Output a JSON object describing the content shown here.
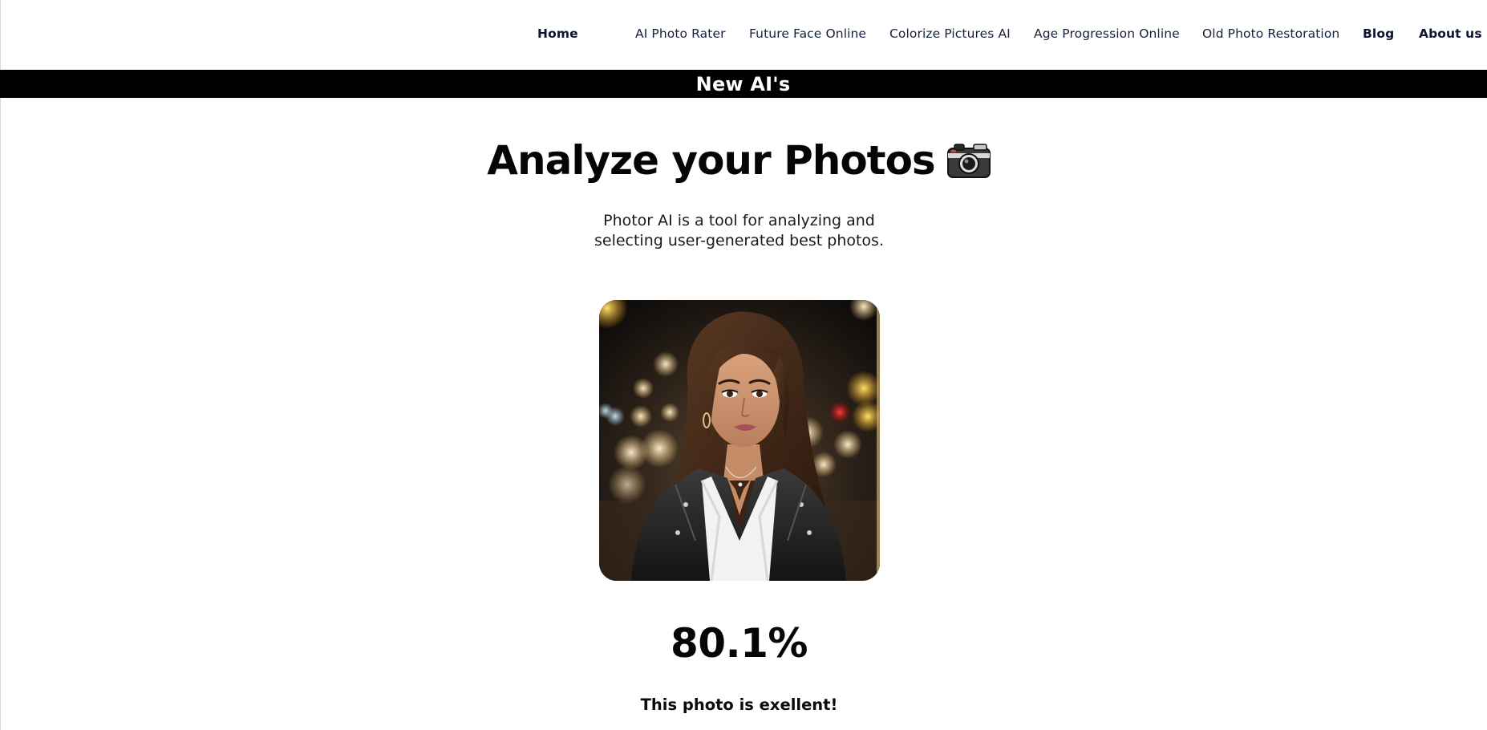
{
  "nav": {
    "items": [
      {
        "label": "Home",
        "bold": true
      },
      {
        "label": "AI Photo Rater",
        "bold": false
      },
      {
        "label": "Future Face Online",
        "bold": false
      },
      {
        "label": "Colorize Pictures AI",
        "bold": false
      },
      {
        "label": "Age Progression Online",
        "bold": false
      },
      {
        "label": "Old Photo Restoration",
        "bold": false
      },
      {
        "label": "Blog",
        "bold": true
      },
      {
        "label": "About us",
        "bold": true
      }
    ]
  },
  "banner": {
    "text": "New AI's"
  },
  "hero": {
    "title": "Analyze your Photos",
    "title_icon": "camera-icon",
    "description": "Photor AI is a tool for analyzing and selecting user-generated best photos."
  },
  "photo": {
    "subject": "portrait-photo"
  },
  "result": {
    "score": "80.1%",
    "verdict": "This photo is exellent!"
  },
  "colors": {
    "banner_bg": "#000000",
    "banner_text": "#ffffff",
    "nav_text": "#16213a"
  }
}
